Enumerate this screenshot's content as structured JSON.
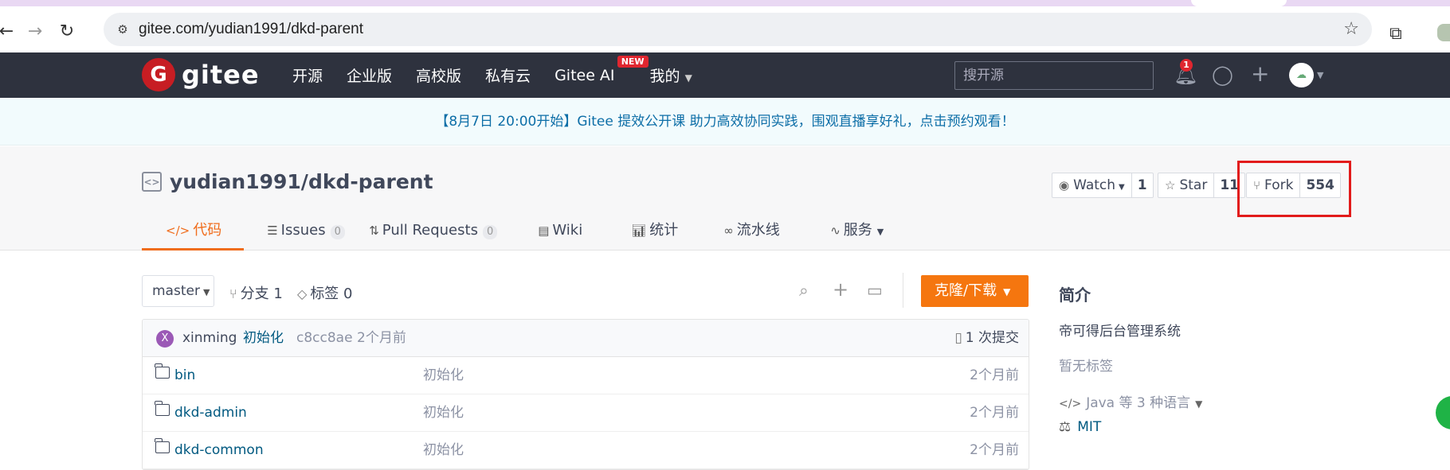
{
  "browser": {
    "url": "gitee.com/yudian1991/dkd-parent",
    "back_icon": "arrow-left-icon",
    "forward_icon": "arrow-right-icon",
    "reload_icon": "reload-icon"
  },
  "header": {
    "logo_text": "gitee",
    "nav": [
      {
        "label": "开源"
      },
      {
        "label": "企业版"
      },
      {
        "label": "高校版"
      },
      {
        "label": "私有云"
      },
      {
        "label": "Gitee AI",
        "badge": "NEW"
      },
      {
        "label": "我的"
      }
    ],
    "search_placeholder": "搜开源",
    "notification_count": "1"
  },
  "banner": {
    "text": "【8月7日 20:00开始】Gitee 提效公开课 助力高效协同实践，围观直播享好礼，点击预约观看！"
  },
  "repo": {
    "full_name": "yudian1991/dkd-parent",
    "watch_label": "Watch",
    "watch_count": "1",
    "star_label": "Star",
    "star_count": "11",
    "fork_label": "Fork",
    "fork_count": "554",
    "highlight_color": "#e21b1b"
  },
  "tabs": [
    {
      "label": "代码",
      "active": true
    },
    {
      "label": "Issues",
      "count": "0"
    },
    {
      "label": "Pull Requests",
      "count": "0"
    },
    {
      "label": "Wiki"
    },
    {
      "label": "统计"
    },
    {
      "label": "流水线"
    },
    {
      "label": "服务"
    }
  ],
  "toolbar": {
    "branch": "master",
    "branches": "分支 1",
    "tags": "标签 0",
    "clone_label": "克隆/下载"
  },
  "commit": {
    "avatar_letter": "X",
    "author": "xinming",
    "message": "初始化",
    "hash": "c8cc8ae",
    "time": "2个月前",
    "count": "1 次提交"
  },
  "files": [
    {
      "name": "bin",
      "message": "初始化",
      "time": "2个月前"
    },
    {
      "name": "dkd-admin",
      "message": "初始化",
      "time": "2个月前"
    },
    {
      "name": "dkd-common",
      "message": "初始化",
      "time": "2个月前"
    }
  ],
  "sidebar": {
    "title": "简介",
    "description": "帝可得后台管理系统",
    "tags": "暂无标签",
    "language": "Java 等 3 种语言",
    "license": "MIT"
  },
  "colors": {
    "accent": "#f06d1d",
    "header_bg": "#2e323e",
    "link": "#005980",
    "clone_button": "#f5760f"
  }
}
